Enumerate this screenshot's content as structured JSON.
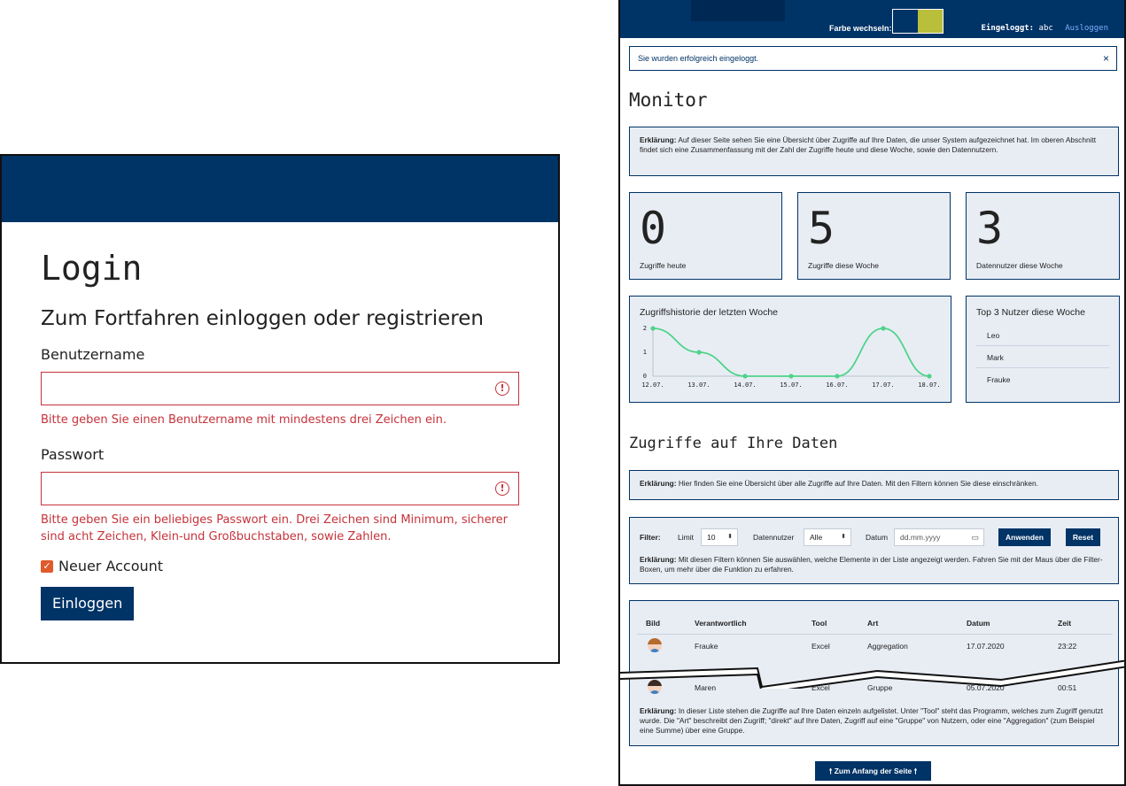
{
  "login": {
    "title": "Login",
    "subtitle": "Zum Fortfahren einloggen oder registrieren",
    "username_label": "Benutzername",
    "username_value": "",
    "username_error": "Bitte geben Sie einen Benutzername mit mindestens drei Zeichen ein.",
    "password_label": "Passwort",
    "password_value": "",
    "password_error": "Bitte geben Sie ein beliebiges Passwort ein. Drei Zeichen sind Minimum, sicherer sind acht Zeichen, Klein-und Großbuchstaben, sowie Zahlen.",
    "new_account_label": "Neuer Account",
    "new_account_checked": true,
    "submit_label": "Einloggen",
    "colors": {
      "header": "#003366",
      "error": "#c6323a",
      "checkbox": "#e05a2b"
    }
  },
  "monitor": {
    "topbar": {
      "color_switch_label": "Farbe wechseln:",
      "color_options": [
        "#003366",
        "#b9be3b"
      ],
      "logged_in_label": "Eingeloggt:",
      "username": "abc",
      "logout_label": "Ausloggen"
    },
    "alert": {
      "text": "Sie wurden erfolgreich eingeloggt.",
      "close": "×"
    },
    "title": "Monitor",
    "intro": {
      "bold": "Erklärung:",
      "text": "Auf dieser Seite sehen Sie eine Übersicht über Zugriffe auf Ihre Daten, die unser System aufgezeichnet hat. Im oberen Abschnitt findet sich eine Zusammenfassung mit der Zahl der Zugriffe heute und diese Woche, sowie den Datennutzern."
    },
    "stats": [
      {
        "value": "0",
        "label": "Zugriffe heute"
      },
      {
        "value": "5",
        "label": "Zugriffe diese Woche"
      },
      {
        "value": "3",
        "label": "Datennutzer diese Woche"
      }
    ],
    "chart_title": "Zugriffshistorie der letzten Woche",
    "top_title": "Top 3 Nutzer diese Woche",
    "top_users": [
      "Leo",
      "Mark",
      "Frauke"
    ],
    "section_title": "Zugriffe auf Ihre Daten",
    "section_intro": {
      "bold": "Erklärung:",
      "text": "Hier finden Sie eine Übersicht über alle Zugriffe auf Ihre Daten. Mit den Filtern können Sie diese einschränken."
    },
    "filter": {
      "label": "Filter:",
      "limit_label": "Limit",
      "limit_value": "10",
      "user_label": "Datennutzer",
      "user_value": "Alle",
      "date_label": "Datum",
      "date_placeholder": "dd.mm.yyyy",
      "apply_label": "Anwenden",
      "reset_label": "Reset",
      "expl_bold": "Erklärung:",
      "expl_text": "Mit diesen Filtern können Sie auswählen, welche Elemente in der Liste angezeigt werden. Fahren Sie mit der Maus über die Filter-Boxen, um mehr über die Funktion zu erfahren."
    },
    "table": {
      "headers": [
        "Bild",
        "Verantwortlich",
        "Tool",
        "Art",
        "Datum",
        "Zeit"
      ],
      "rows": [
        {
          "name": "Frauke",
          "tool": "Excel",
          "art": "Aggregation",
          "date": "17.07.2020",
          "time": "23:22"
        },
        {
          "name": "Maren",
          "tool": "Excel",
          "art": "Gruppe",
          "date": "05.07.2020",
          "time": "00:51"
        }
      ],
      "expl_bold": "Erklärung:",
      "expl_text": "In dieser Liste stehen die Zugriffe auf Ihre Daten einzeln aufgelistet. Unter \"Tool\" steht das Programm, welches zum Zugriff genutzt wurde. Die \"Art\" beschreibt den Zugriff; \"direkt\" auf Ihre Daten, Zugriff auf eine \"Gruppe\" von Nutzern, oder eine \"Aggregation\" (zum Beispiel eine Summe) über eine Gruppe."
    },
    "back_to_top": "🠕 Zum Anfang der Seite 🠕"
  },
  "chart_data": {
    "type": "line",
    "title": "Zugriffshistorie der letzten Woche",
    "categories": [
      "12.07.",
      "13.07.",
      "14.07.",
      "15.07.",
      "16.07.",
      "17.07.",
      "18.07."
    ],
    "values": [
      2,
      1,
      0,
      0,
      0,
      2,
      0
    ],
    "yticks": [
      "0",
      "1",
      "2"
    ],
    "ylim": [
      0,
      2
    ],
    "color": "#4fd38a",
    "grid": false
  }
}
